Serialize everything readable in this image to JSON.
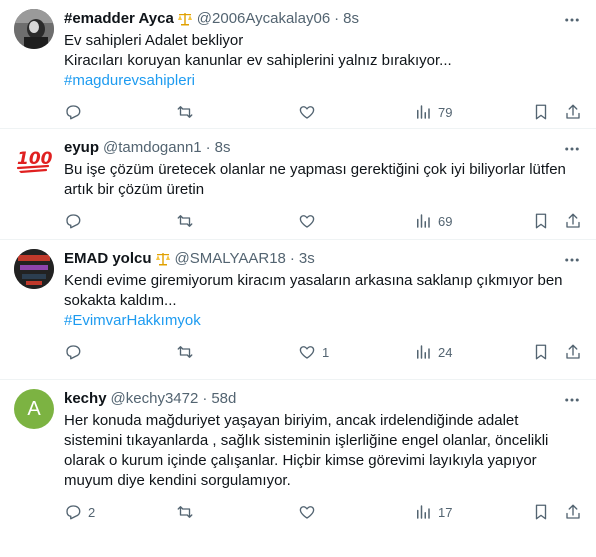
{
  "tweets": [
    {
      "name": "#emadder Ayca",
      "badge": "⚖️",
      "handle": "@2006Aycakalay06",
      "time": "8s",
      "lines": [
        "Ev sahipleri Adalet bekliyor",
        "Kiracıları koruyan kanunlar ev sahiplerini yalnız bırakıyor..."
      ],
      "hashtag": "#magdurevsahipleri",
      "replies": "",
      "retweets": "",
      "likes": "",
      "views": "79"
    },
    {
      "name": "eyup",
      "badge": "",
      "handle": "@tamdogann1",
      "time": "8s",
      "lines": [
        "Bu işe çözüm üretecek olanlar ne yapması gerektiğini çok iyi biliyorlar lütfen",
        "artık bir çözüm üretin"
      ],
      "hashtag": "",
      "replies": "",
      "retweets": "",
      "likes": "",
      "views": "69"
    },
    {
      "name": "EMAD yolcu",
      "badge": "⚖️",
      "handle": "@SMALYAAR18",
      "time": "3s",
      "lines": [
        "Kendi evime giremiyorum kiracım yasaların arkasına saklanıp çıkmıyor ben",
        "sokakta kaldım..."
      ],
      "hashtag": "#EvimvarHakkımyok",
      "replies": "",
      "retweets": "",
      "likes": "1",
      "views": "24"
    },
    {
      "name": "kechy",
      "badge": "",
      "handle": "@kechy3472",
      "time": "58d",
      "lines": [
        "Her konuda mağduriyet yaşayan biriyim, ancak irdelendiğinde adalet",
        "sistemini tıkayanlarda , sağlık sisteminin işlerliğine engel olanlar, öncelikli",
        "olarak o kurum içinde çalışanlar. Hiçbir kimse görevimi layıkıyla yapıyor",
        "muyum diye kendini sorgulamıyor."
      ],
      "hashtag": "",
      "replies": "2",
      "retweets": "",
      "likes": "",
      "views": "17"
    }
  ],
  "avatars": [
    "photo",
    "100-emoji",
    "image",
    "A"
  ],
  "dot": "·",
  "colors": {
    "accent": "#1d9bf0",
    "muted": "#536471",
    "text": "#0f1419",
    "avatar_letter_bg": "#7cb342"
  }
}
